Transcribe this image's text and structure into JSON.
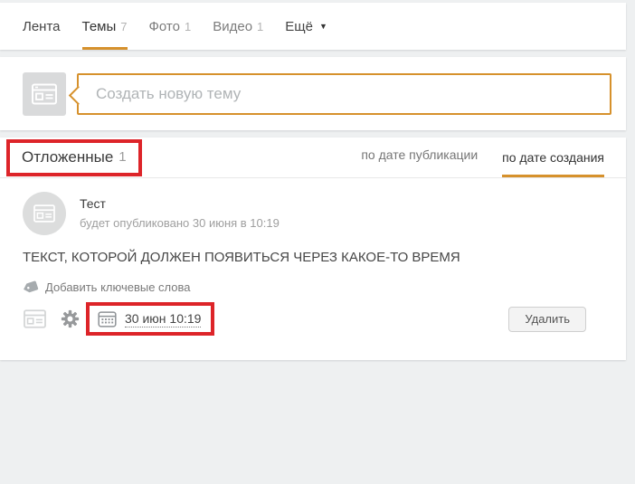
{
  "theme": {
    "accent_orange": "#d6912c",
    "annotation_red": "#dd2429",
    "page_bg": "#eef0f1"
  },
  "nav": {
    "items": [
      {
        "label": "Лента",
        "count": ""
      },
      {
        "label": "Темы",
        "count": "7"
      },
      {
        "label": "Фото",
        "count": "1"
      },
      {
        "label": "Видео",
        "count": "1"
      },
      {
        "label": "Ещё",
        "count": "",
        "caret": "▼"
      }
    ]
  },
  "composer": {
    "placeholder": "Создать новую тему",
    "icon": "news-feed-icon"
  },
  "section": {
    "title": "Отложенные",
    "count": "1",
    "sort_tabs": [
      {
        "label": "по дате публикации"
      },
      {
        "label": "по дате создания"
      }
    ]
  },
  "post": {
    "author": "Тест",
    "publish_info": "будет опубликовано 30 июня в 10:19",
    "body": "ТЕКСТ, КОТОРОЙ ДОЛЖЕН ПОЯВИТЬСЯ ЧЕРЕЗ КАКОЕ-ТО ВРЕМЯ",
    "add_keywords_label": "Добавить ключевые слова",
    "scheduled_time": "30 июн 10:19",
    "delete_button_label": "Удалить",
    "icons": {
      "avatar": "news-feed-icon",
      "attachment": "news-feed-icon",
      "settings": "gear-icon",
      "schedule": "calendar-icon",
      "keywords": "tag-icon"
    }
  }
}
